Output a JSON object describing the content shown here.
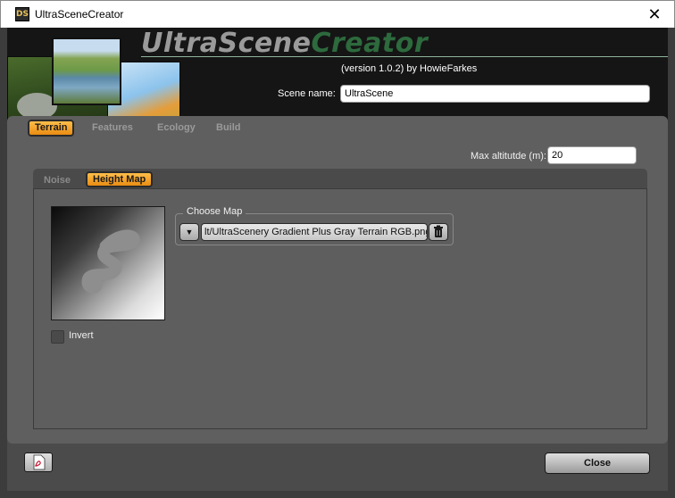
{
  "window": {
    "title": "UltraSceneCreator",
    "icon_text": "DS",
    "close_glyph": "✕"
  },
  "header": {
    "logo_ultra": "UltraScene",
    "logo_creator": "Creator",
    "version": "(version 1.0.2) by HowieFarkes",
    "scene_name_label": "Scene name:",
    "scene_name_value": "UltraScene"
  },
  "tabs": [
    {
      "label": "Terrain",
      "active": true
    },
    {
      "label": "Features",
      "active": false
    },
    {
      "label": "Ecology",
      "active": false
    },
    {
      "label": "Build",
      "active": false
    }
  ],
  "terrain": {
    "max_altitude_label": "Max altitutde (m):",
    "max_altitude_value": "20",
    "subtabs": [
      {
        "label": "Noise",
        "active": false
      },
      {
        "label": "Height Map",
        "active": true
      }
    ],
    "invert_label": "Invert",
    "invert_checked": false,
    "choose_map_title": "Choose Map",
    "map_path": "lt/UltraScenery Gradient Plus Gray Terrain RGB.png"
  },
  "footer": {
    "close_label": "Close"
  },
  "icons": {
    "pdf": "pdf-icon",
    "trash": "trash-icon",
    "dropdown": "dropdown-arrow-icon"
  },
  "colors": {
    "accent_orange": "#f5a623",
    "logo_green": "#2d6a3d",
    "panel_bg": "#5f5f5f"
  }
}
